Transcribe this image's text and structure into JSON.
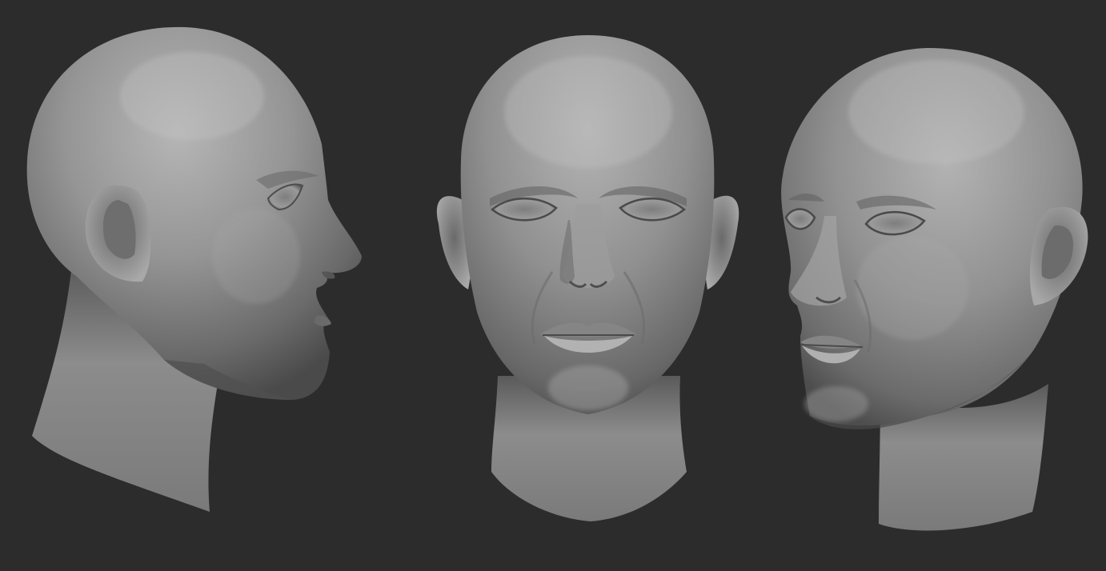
{
  "scene": {
    "background": "#2c2c2c",
    "clay_colors": {
      "highlight": "#b4b4b4",
      "mid": "#8e8e8e",
      "shadow": "#4e4e4e",
      "deep_shadow": "#333333"
    },
    "views": [
      {
        "view": "left-profile"
      },
      {
        "view": "front"
      },
      {
        "view": "three-quarter"
      }
    ]
  }
}
